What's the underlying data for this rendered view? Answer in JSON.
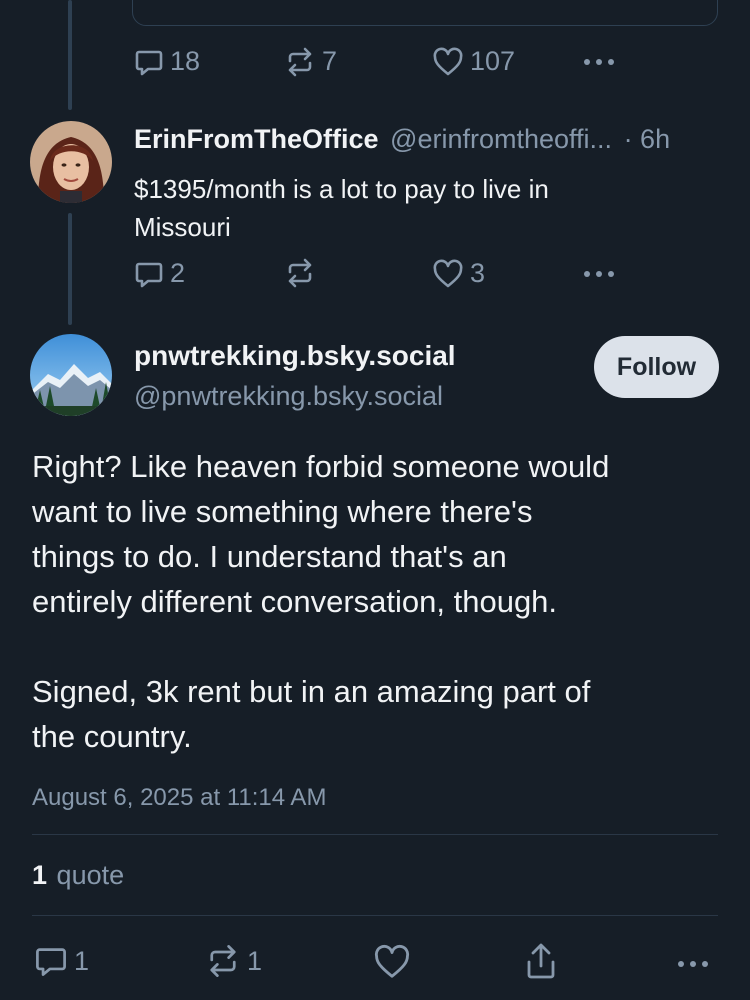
{
  "parent_post": {
    "actions": {
      "replies": "18",
      "reposts": "7",
      "likes": "107"
    }
  },
  "reply_post": {
    "display_name": "ErinFromTheOffice",
    "handle": "@erinfromtheoffi...",
    "time": "· 6h",
    "text_line1": "$1395/month is a lot to pay to live in",
    "text_line2": "Missouri",
    "actions": {
      "replies": "2",
      "likes": "3"
    }
  },
  "main_post": {
    "display_name": "pnwtrekking.bsky.social",
    "handle": "@pnwtrekking.bsky.social",
    "follow_label": "Follow",
    "paragraph1": [
      "Right? Like heaven forbid someone would",
      "want to live something where there's",
      "things to do. I understand that's an",
      "entirely different conversation, though."
    ],
    "paragraph2": [
      "Signed, 3k rent but in an amazing part of",
      "the country."
    ],
    "timestamp": "August 6, 2025 at 11:14 AM",
    "quote_count": "1",
    "quote_label": "quote",
    "actions": {
      "replies": "1",
      "reposts": "1"
    }
  },
  "colors": {
    "background": "#161e27",
    "muted_text": "#8798ab",
    "thread_line": "#2e4052",
    "follow_button": "#dce2ea"
  },
  "icons": [
    "reply-icon",
    "repost-icon",
    "like-icon",
    "more-icon",
    "share-icon"
  ]
}
